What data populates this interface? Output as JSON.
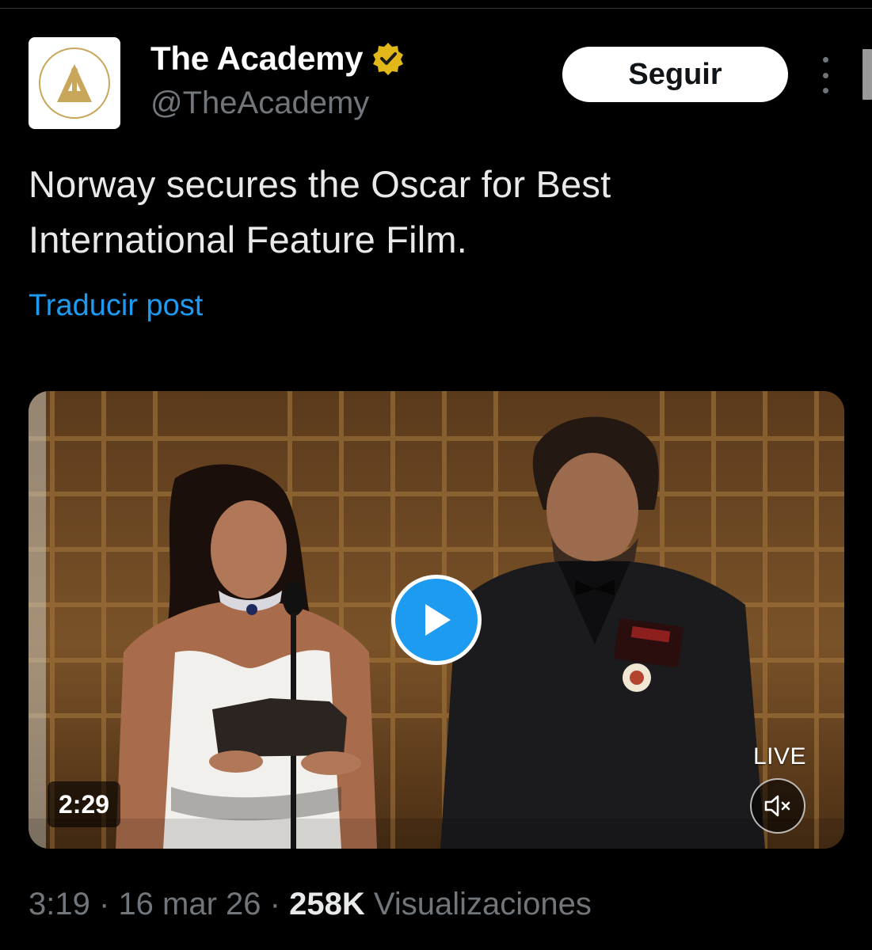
{
  "author": {
    "display_name": "The Academy",
    "handle": "@TheAcademy",
    "avatar_icon": "oscar-statuette-icon",
    "verified_icon": "verified-gold-badge-icon",
    "verified_color": "#e2b719"
  },
  "actions": {
    "follow_label": "Seguir",
    "more_icon": "more-vertical-icon"
  },
  "tweet": {
    "text": "Norway secures the Oscar for Best International Feature Film.",
    "translate_label": "Traducir post"
  },
  "media": {
    "type": "video",
    "duration": "2:29",
    "live_label": "LIVE",
    "play_icon": "play-icon",
    "mute_icon": "volume-muted-icon",
    "accent": "#1d9bf0"
  },
  "meta": {
    "time": "3:19",
    "separator": "·",
    "date": "16 mar 26",
    "views_count": "258K",
    "views_label": "Visualizaciones"
  },
  "colors": {
    "background": "#000000",
    "text_primary": "#e7e9ea",
    "text_secondary": "#71767b",
    "link": "#1d9bf0",
    "gold": "#c8a75a"
  }
}
